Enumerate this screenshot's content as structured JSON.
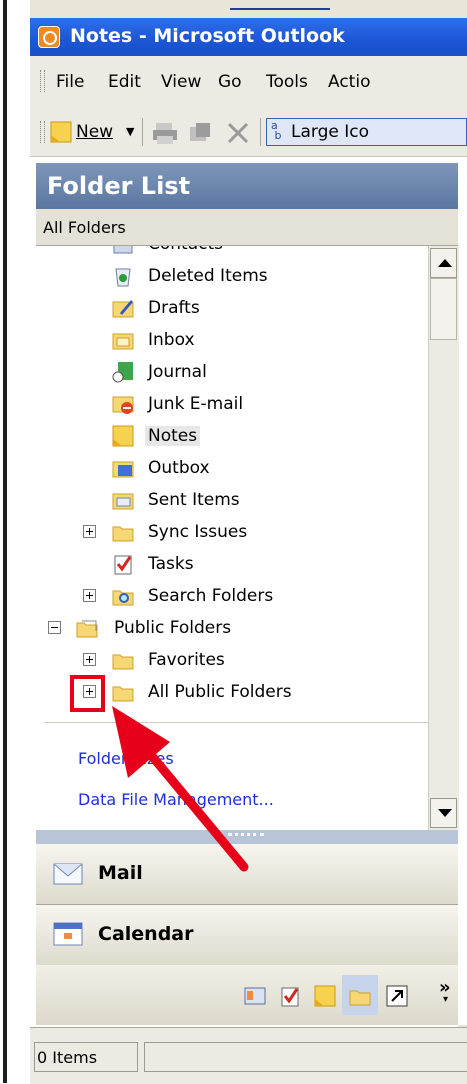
{
  "window": {
    "title": "Notes - Microsoft Outlook"
  },
  "menu": {
    "items": [
      "File",
      "Edit",
      "View",
      "Go",
      "Tools",
      "Actio"
    ]
  },
  "toolbar": {
    "new_label": "New",
    "view_label": "Large Ico"
  },
  "folder_list": {
    "header": "Folder List",
    "scope": "All Folders",
    "items": [
      {
        "label": "Contacts",
        "icon": "contacts-icon"
      },
      {
        "label": "Deleted Items",
        "icon": "trash-icon"
      },
      {
        "label": "Drafts",
        "icon": "drafts-icon"
      },
      {
        "label": "Inbox",
        "icon": "inbox-icon"
      },
      {
        "label": "Journal",
        "icon": "journal-icon"
      },
      {
        "label": "Junk E-mail",
        "icon": "junk-mail-icon"
      },
      {
        "label": "Notes",
        "icon": "notes-icon",
        "selected": true
      },
      {
        "label": "Outbox",
        "icon": "outbox-icon"
      },
      {
        "label": "Sent Items",
        "icon": "sent-items-icon"
      },
      {
        "label": "Sync Issues",
        "icon": "folder-icon",
        "expandable": true
      },
      {
        "label": "Tasks",
        "icon": "tasks-icon"
      },
      {
        "label": "Search Folders",
        "icon": "search-folder-icon",
        "expandable": true
      },
      {
        "label": "Public Folders",
        "icon": "public-folders-icon",
        "expanded": true
      },
      {
        "label": "Favorites",
        "icon": "folder-icon",
        "expandable": true
      },
      {
        "label": "All Public Folders",
        "icon": "folder-icon",
        "expandable": true
      }
    ],
    "links": [
      "Folder Sizes",
      "Data File Management..."
    ]
  },
  "nav": {
    "mail_label": "Mail",
    "calendar_label": "Calendar"
  },
  "status": {
    "items_text": "0 Items"
  },
  "colors": {
    "titlebar": "#1b56d6",
    "header": "#6d87af",
    "link": "#1d2fd6",
    "annotation": "#e6001a"
  }
}
